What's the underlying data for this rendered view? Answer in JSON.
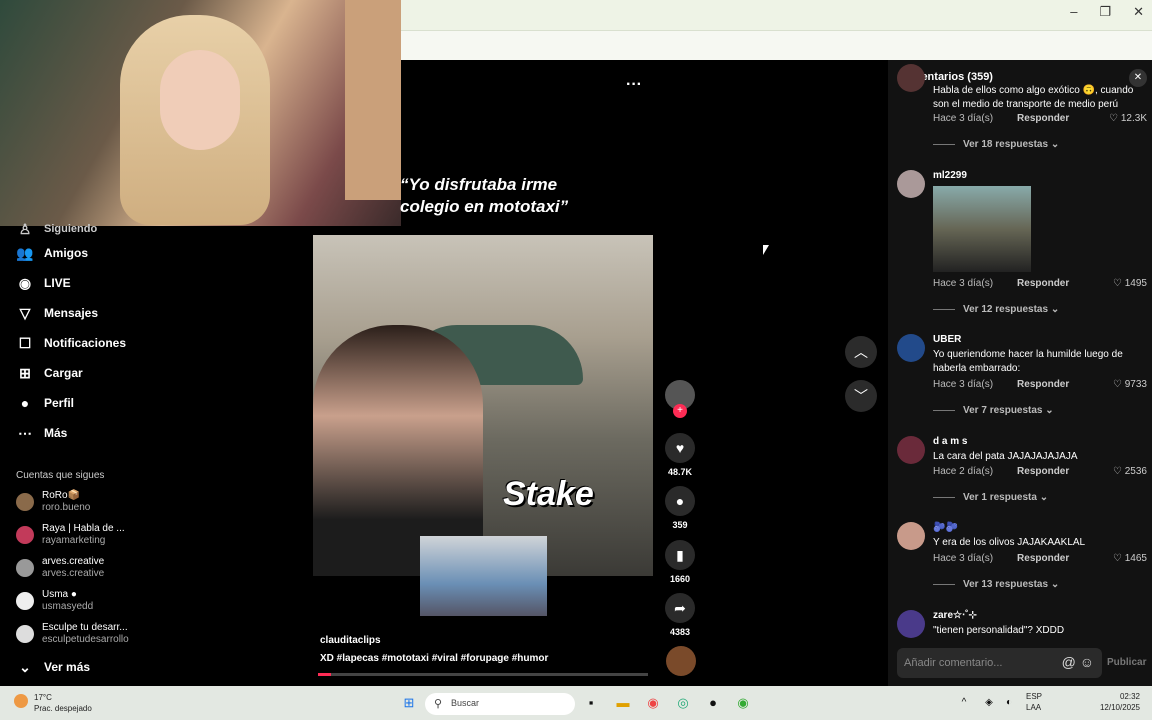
{
  "browser": {
    "window_buttons": [
      "–",
      "❐",
      "✕"
    ],
    "toolbar_icons": [
      "⇩",
      "⤢",
      "★",
      "◆",
      "⋮"
    ]
  },
  "sidebar": {
    "partial_item": "Siguiendo",
    "items": [
      {
        "label": "Amigos",
        "icon": "friends-icon",
        "glyph": "👥"
      },
      {
        "label": "LIVE",
        "icon": "live-icon",
        "glyph": "◉"
      },
      {
        "label": "Mensajes",
        "icon": "messages-icon",
        "glyph": "▽"
      },
      {
        "label": "Notificaciones",
        "icon": "notifications-icon",
        "glyph": "☐"
      },
      {
        "label": "Cargar",
        "icon": "upload-icon",
        "glyph": "⊞"
      },
      {
        "label": "Perfil",
        "icon": "profile-icon",
        "glyph": "●"
      },
      {
        "label": "Más",
        "icon": "more-icon",
        "glyph": "⋯"
      }
    ],
    "following_header": "Cuentas que sigues",
    "following": [
      {
        "name": "RoRo📦",
        "user": "roro.bueno"
      },
      {
        "name": "Raya | Habla de ...",
        "user": "rayamarketing"
      },
      {
        "name": "arves.creative",
        "user": "arves.creative"
      },
      {
        "name": "Usma ●",
        "user": "usmasyedd"
      },
      {
        "name": "Esculpe tu desarr...",
        "user": "esculpetudesarrollo"
      }
    ],
    "see_more": "Ver más"
  },
  "video": {
    "caption_line1": "“Yo disfrutaba irme",
    "caption_line2": "colegio en mototaxi”",
    "overlay_brand": "Stake",
    "author": "clauditaclips",
    "description": "XD #lapecas  #mototaxi  #viral  #forupage  #humor",
    "progress": 0.04,
    "more_options": "···"
  },
  "actions": {
    "likes": "48.7K",
    "comments": "359",
    "saves": "1660",
    "shares": "4383"
  },
  "comments_panel": {
    "title": "Comentarios (359)",
    "input_placeholder": "Añadir comentario...",
    "publish": "Publicar",
    "reply_label": "Responder",
    "items": [
      {
        "user": "",
        "text": "Habla de ellos como algo exótico 🙃, cuando son el medio de transporte de medio perú",
        "time": "Hace 3 día(s)",
        "likes": "12.3K",
        "replies": "Ver 18 respuestas ⌄"
      },
      {
        "user": "ml2299",
        "text": "",
        "time": "Hace 3 día(s)",
        "likes": "1495",
        "replies": "Ver 12 respuestas ⌄"
      },
      {
        "user": "UBER",
        "text": "Yo queriendome hacer la humilde luego de haberla embarrado:",
        "time": "Hace 3 día(s)",
        "likes": "9733",
        "replies": "Ver 7 respuestas ⌄"
      },
      {
        "user": "d a m s",
        "text": "La cara del pata JAJAJAJAJAJA",
        "time": "Hace 2 día(s)",
        "likes": "2536",
        "replies": "Ver 1 respuesta ⌄"
      },
      {
        "user": "🫐🫐",
        "text": "Y era de los olivos JAJAKAAKLAL",
        "time": "Hace 3 día(s)",
        "likes": "1465",
        "replies": "Ver 13 respuestas ⌄"
      },
      {
        "user": "zare☆‧˚⊹",
        "text": "\"tienen personalidad\"? XDDD",
        "time": "",
        "likes": "",
        "replies": ""
      }
    ]
  },
  "taskbar": {
    "temp": "17°C",
    "weather": "Prac. despejado",
    "search": "Buscar",
    "lang1": "ESP",
    "lang2": "LAA",
    "time": "02:32",
    "date": "12/10/2025"
  }
}
